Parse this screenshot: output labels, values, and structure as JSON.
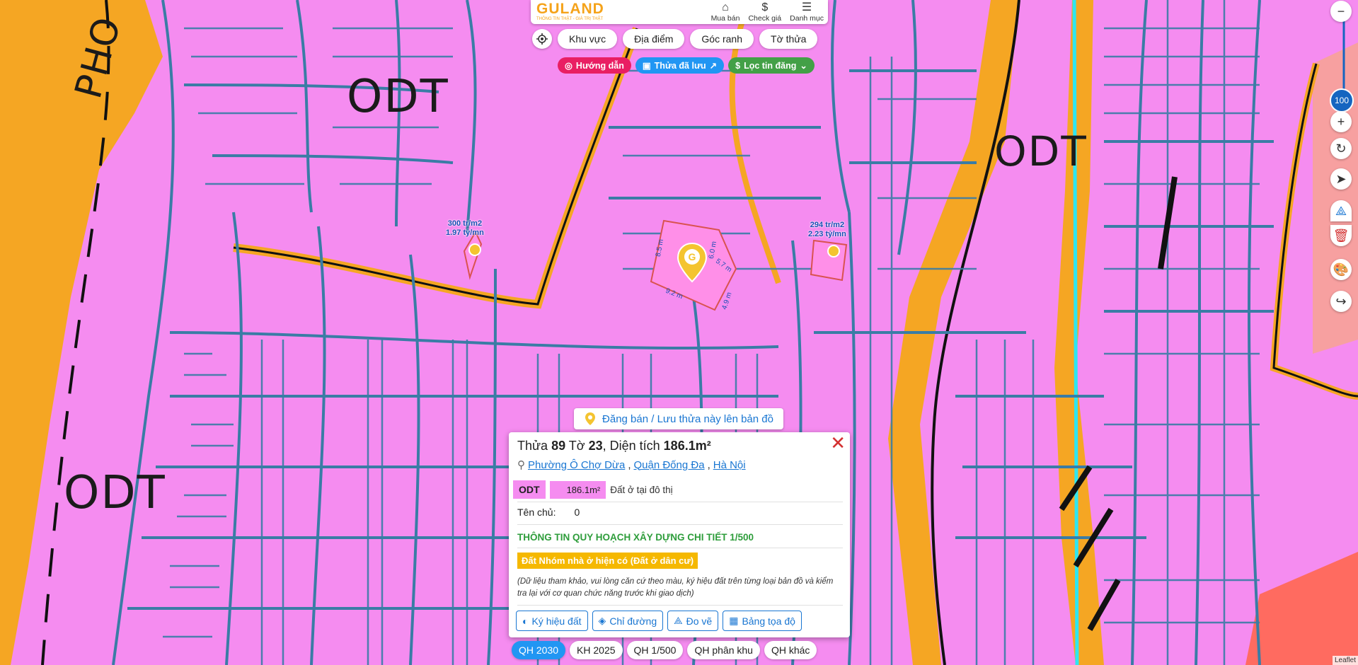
{
  "header": {
    "logo_main": "GULAND",
    "logo_sub": "THÔNG TIN THẬT - GIÁ TRỊ THẬT",
    "nav": [
      {
        "label": "Mua bán",
        "icon": "house-icon"
      },
      {
        "label": "Check giá",
        "icon": "dollar-icon"
      },
      {
        "label": "Danh mục",
        "icon": "menu-icon"
      }
    ]
  },
  "filters": [
    "Khu vực",
    "Địa điểm",
    "Góc ranh",
    "Tờ thửa"
  ],
  "tags": [
    {
      "label": "Hướng dẫn",
      "color": "#e91e63"
    },
    {
      "label": "Thửa đã lưu",
      "color": "#2196f3"
    },
    {
      "label": "Lọc tin đăng",
      "color": "#43a047"
    }
  ],
  "zoom": {
    "level": "100"
  },
  "map_labels": [
    "ODT",
    "ODT",
    "ODT",
    "PHO"
  ],
  "prices": [
    {
      "line1": "300 tr/m2",
      "line2": "1.97 tỷ/mn"
    },
    {
      "line1": "294 tr/m2",
      "line2": "2.23 tỷ/mn"
    }
  ],
  "parcel_dims": [
    "8.5 m",
    "6.0 m",
    "5.7 m",
    "9.2 m",
    "4.9 m"
  ],
  "post_button": "Đăng bán / Lưu thửa này lên bản đồ",
  "card": {
    "t1": "Thửa ",
    "parcel": "89",
    "t2": " Tờ ",
    "sheet": "23",
    "t3": ", Diện tích ",
    "area": "186.1m²",
    "ward": "Phường Ô Chợ Dừa",
    "district": "Quận Đống Đa",
    "city": "Hà Nội",
    "land_type": "ODT",
    "land_area": "186.1m²",
    "land_desc": "Đất ở tại đô thị",
    "owner_label": "Tên chủ:",
    "owner_value": "0",
    "plan_title": "THÔNG TIN QUY HOẠCH XÂY DỰNG CHI TIẾT 1/500",
    "plan_tag": "Đất Nhóm nhà ở hiện có (Đất ở dân cư)",
    "note": "(Dữ liệu tham khảo, vui lòng căn cứ theo màu, ký hiệu đất trên từng loại bản đồ và kiểm tra lại với cơ quan chức năng trước khi giao dịch)",
    "buttons": [
      "Ký hiệu đất",
      "Chỉ đường",
      "Đo vẽ",
      "Bảng tọa độ"
    ]
  },
  "plan_tabs": [
    "QH 2030",
    "KH 2025",
    "QH 1/500",
    "QH phân khu",
    "QH khác"
  ],
  "attribution": "Leaflet",
  "colors": {
    "residential": "#f58cf0",
    "road": "#f5a623",
    "parcel_line": "#3a7ca5",
    "accent": "#1976d2"
  }
}
